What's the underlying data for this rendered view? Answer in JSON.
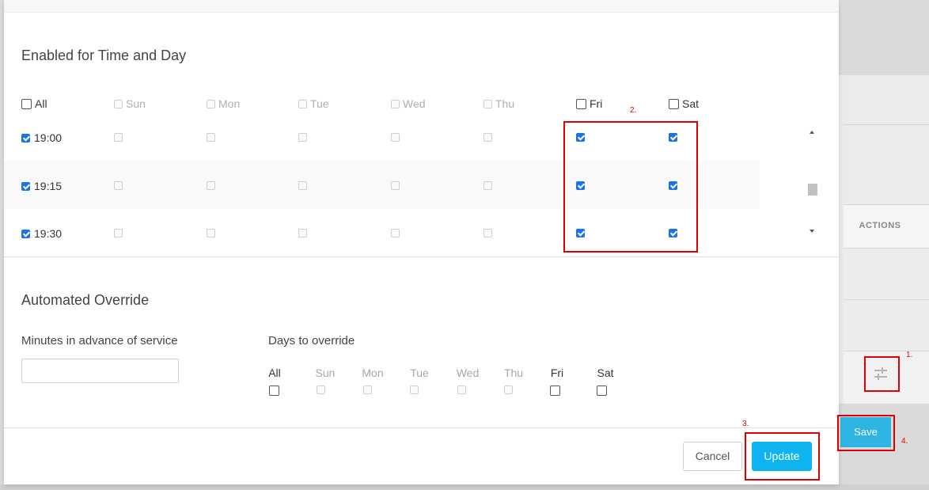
{
  "background": {
    "actions_header": "ACTIONS",
    "save_label": "Save",
    "filter_icon": "sliders-icon"
  },
  "time_day": {
    "title": "Enabled for Time and Day",
    "days": [
      {
        "label": "All",
        "checked": false,
        "enabled": true
      },
      {
        "label": "Sun",
        "checked": false,
        "enabled": false
      },
      {
        "label": "Mon",
        "checked": false,
        "enabled": false
      },
      {
        "label": "Tue",
        "checked": false,
        "enabled": false
      },
      {
        "label": "Wed",
        "checked": false,
        "enabled": false
      },
      {
        "label": "Thu",
        "checked": false,
        "enabled": false
      },
      {
        "label": "Fri",
        "checked": false,
        "enabled": true
      },
      {
        "label": "Sat",
        "checked": false,
        "enabled": true
      }
    ],
    "rows": [
      {
        "time": "19:00",
        "checked": true,
        "fri": true,
        "sat": true
      },
      {
        "time": "19:15",
        "checked": true,
        "fri": true,
        "sat": true
      },
      {
        "time": "19:30",
        "checked": true,
        "fri": true,
        "sat": true
      }
    ]
  },
  "override": {
    "title": "Automated Override",
    "minutes_label": "Minutes in advance of service",
    "minutes_value": "",
    "days_label": "Days to override",
    "days": [
      {
        "label": "All",
        "enabled": true
      },
      {
        "label": "Sun",
        "enabled": false
      },
      {
        "label": "Mon",
        "enabled": false
      },
      {
        "label": "Tue",
        "enabled": false
      },
      {
        "label": "Wed",
        "enabled": false
      },
      {
        "label": "Thu",
        "enabled": false
      },
      {
        "label": "Fri",
        "enabled": true
      },
      {
        "label": "Sat",
        "enabled": true
      }
    ]
  },
  "footer": {
    "cancel_label": "Cancel",
    "update_label": "Update"
  },
  "annotations": [
    "1.",
    "2.",
    "3.",
    "4."
  ],
  "colors": {
    "accent": "#0db4ef",
    "annotation": "#e00000",
    "checkbox_checked": "#1a73e8"
  }
}
